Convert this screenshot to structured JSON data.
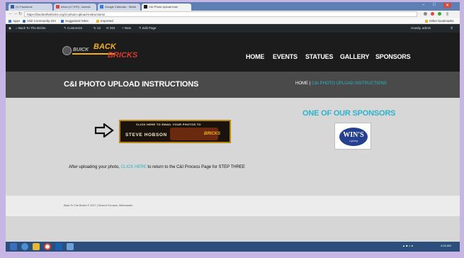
{
  "browser": {
    "tabs": [
      {
        "label": "(1) Facebook"
      },
      {
        "label": "Inbox (17,970) - lacenic"
      },
      {
        "label": "Google Calendar - Week"
      },
      {
        "label": "C&I Photo Upload Instr"
      }
    ],
    "url": "https://backtothebricks.org/ci-photo-upload-instructions/",
    "bookmarks": [
      "Apps",
      "Visit Community Gm",
      "Suggested Sites",
      "Imported",
      "Other bookmarks"
    ]
  },
  "admin_bar": {
    "items": [
      "Back To The Bricks",
      "Customize",
      "12",
      "204",
      "New",
      "Edit Page"
    ],
    "howdy": "Howdy, admin"
  },
  "site": {
    "logo": {
      "word1": "BUICK",
      "word2": "BACK",
      "word3": "BRICKS"
    },
    "nav": [
      "HOME",
      "EVENTS",
      "STATUES",
      "GALLERY",
      "SPONSORS"
    ]
  },
  "page": {
    "title": "C&I PHOTO UPLOAD INSTRUCTIONS",
    "breadcrumb": {
      "home": "HOME",
      "separator": " | ",
      "current": "C&I PHOTO UPLOAD INSTRUCTIONS"
    }
  },
  "content": {
    "banner": {
      "top_text": "CLICK HERE TO EMAIL YOUR PHOTOS TO",
      "name": "STEVE HOBSON"
    },
    "instruction": {
      "before": "After uploading your photo, ",
      "link": "CLICK HERE",
      "after": " to return to the C&I Process Page for STEP THREE"
    }
  },
  "sidebar": {
    "heading": "ONE OF OUR SPONSORS",
    "sponsor": {
      "name": "WIN'S",
      "tagline": "Lighting"
    }
  },
  "footer": {
    "copyright": "Back To The Bricks © 2017 | Search Furnace, Webmaster"
  },
  "taskbar": {
    "time": "4:03 AM"
  },
  "colors": {
    "accent": "#2bb3c9",
    "header": "#1c1c1c",
    "title_band": "#4a4a4a"
  }
}
